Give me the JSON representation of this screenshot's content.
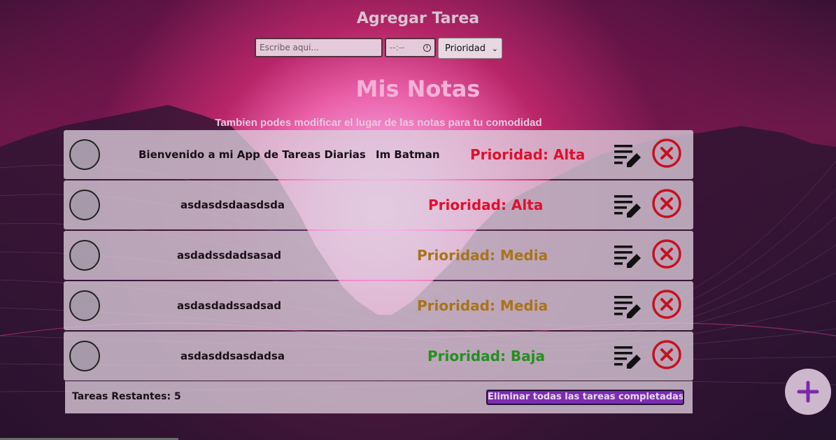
{
  "header": {
    "title": "Agregar Tarea"
  },
  "form": {
    "task_placeholder": "Escribe aqui...",
    "time_placeholder": "--:--",
    "priority_select": "Prioridad"
  },
  "notes": {
    "title": "Mis Notas",
    "subtitle": "Tambien podes modificar el lugar de las notas para tu comodidad"
  },
  "tasks": [
    {
      "text": "Bienvenido a mi App de Tareas Diarias",
      "time": "Im Batman",
      "priority": "Prioridad: Alta",
      "level": "alta"
    },
    {
      "text": "asdasdsdaasdsda",
      "time": "",
      "priority": "Prioridad: Alta",
      "level": "alta"
    },
    {
      "text": "asdadssdadsasad",
      "time": "",
      "priority": "Prioridad: Media",
      "level": "media"
    },
    {
      "text": "asdasdadssadsad",
      "time": "",
      "priority": "Prioridad: Media",
      "level": "media"
    },
    {
      "text": "asdasddsasdadsa",
      "time": "",
      "priority": "Prioridad: Baja",
      "level": "baja"
    }
  ],
  "footer": {
    "remaining": "Tareas Restantes: 5",
    "clear_button": "Eliminar todas las tareas completadas"
  },
  "icons": {
    "edit": "edit-note-icon",
    "delete": "delete-circle-icon",
    "add": "plus-icon",
    "clock": "clock-icon",
    "chevron": "chevron-down-icon"
  },
  "colors": {
    "priority_high": "#e0102e",
    "priority_medium": "#a8741a",
    "priority_low": "#23901f",
    "delete_red": "#c8101e",
    "clear_button": "#7c2db0",
    "add_icon": "#7a2aa8"
  }
}
